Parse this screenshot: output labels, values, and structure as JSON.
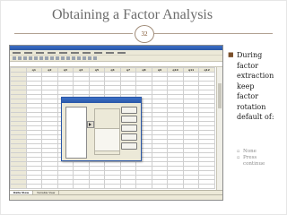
{
  "slide": {
    "title": "Obtaining a Factor Analysis",
    "page_number": "32"
  },
  "screenshot": {
    "columns": [
      "q1",
      "q2",
      "q3",
      "q4",
      "q5",
      "q6",
      "q7",
      "q8",
      "q9",
      "q10",
      "q11",
      "q12"
    ],
    "tabs": [
      "Data View",
      "Variable View"
    ]
  },
  "bullets": {
    "main": "During\nfactor\nextraction\nkeep\nfactor\nrotation\ndefault of:",
    "subitems": [
      "None",
      "Press\ncontinue"
    ]
  }
}
